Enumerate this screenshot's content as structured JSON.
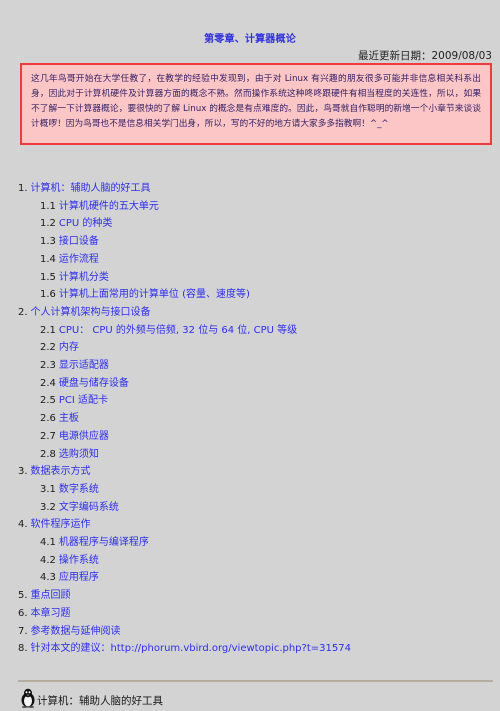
{
  "header": {
    "title": "第零章、计算器概论",
    "update_date": "最近更新日期：2009/08/03"
  },
  "notice": {
    "text": "这几年鸟哥开始在大学任教了，在教学的经验中发现到，由于对 Linux 有兴趣的朋友很多可能并非信息相关科系出身，因此对于计算机硬件及计算器方面的概念不熟。然而操作系统这种咚咚跟硬件有相当程度的关连性，所以，如果不了解一下计算器概论，要很快的了解 Linux 的概念是有点难度的。因此，鸟哥就自作聪明的新增一个小章节来谈谈计概啰！因为鸟哥也不是信息相关学门出身，所以，写的不好的地方请大家多多指教啊！^_^",
    "border_color": "#ee3b3b",
    "background_color": "#fdc6c6"
  },
  "toc": {
    "items": [
      {
        "num": "1.",
        "label": "计算机：辅助人脑的好工具",
        "level": 1
      },
      {
        "num": "1.1",
        "label": "计算机硬件的五大单元",
        "level": 2
      },
      {
        "num": "1.2",
        "label": "CPU 的种类",
        "level": 2
      },
      {
        "num": "1.3",
        "label": "接口设备",
        "level": 2
      },
      {
        "num": "1.4",
        "label": "运作流程",
        "level": 2
      },
      {
        "num": "1.5",
        "label": "计算机分类",
        "level": 2
      },
      {
        "num": "1.6",
        "label": "计算机上面常用的计算单位 (容量、速度等)",
        "level": 2
      },
      {
        "num": "2.",
        "label": "个人计算机架构与接口设备",
        "level": 1
      },
      {
        "num": "2.1",
        "label": "CPU： CPU 的外频与倍频, 32 位与 64 位, CPU 等级",
        "level": 2
      },
      {
        "num": "2.2",
        "label": "内存",
        "level": 2
      },
      {
        "num": "2.3",
        "label": "显示适配器",
        "level": 2
      },
      {
        "num": "2.4",
        "label": "硬盘与储存设备",
        "level": 2
      },
      {
        "num": "2.5",
        "label": "PCI 适配卡",
        "level": 2
      },
      {
        "num": "2.6",
        "label": "主板",
        "level": 2
      },
      {
        "num": "2.7",
        "label": "电源供应器",
        "level": 2
      },
      {
        "num": "2.8",
        "label": "选购须知",
        "level": 2
      },
      {
        "num": "3.",
        "label": "数据表示方式",
        "level": 1
      },
      {
        "num": "3.1",
        "label": "数字系统",
        "level": 2
      },
      {
        "num": "3.2",
        "label": "文字编码系统",
        "level": 2
      },
      {
        "num": "4.",
        "label": "软件程序运作",
        "level": 1
      },
      {
        "num": "4.1",
        "label": "机器程序与编译程序",
        "level": 2
      },
      {
        "num": "4.2",
        "label": "操作系统",
        "level": 2
      },
      {
        "num": "4.3",
        "label": "应用程序",
        "level": 2
      },
      {
        "num": "5.",
        "label": "重点回顾",
        "level": 1
      },
      {
        "num": "6.",
        "label": "本章习题",
        "level": 1
      },
      {
        "num": "7.",
        "label": "参考数据与延伸阅读",
        "level": 1
      },
      {
        "num": "8.",
        "label": "针对本文的建议：http://phorum.vbird.org/viewtopic.php?t=31574",
        "level": 1
      }
    ],
    "link_color": "#2d2dee"
  },
  "section": {
    "icon": "penguin-icon",
    "heading": "计算机：辅助人脑的好工具"
  }
}
